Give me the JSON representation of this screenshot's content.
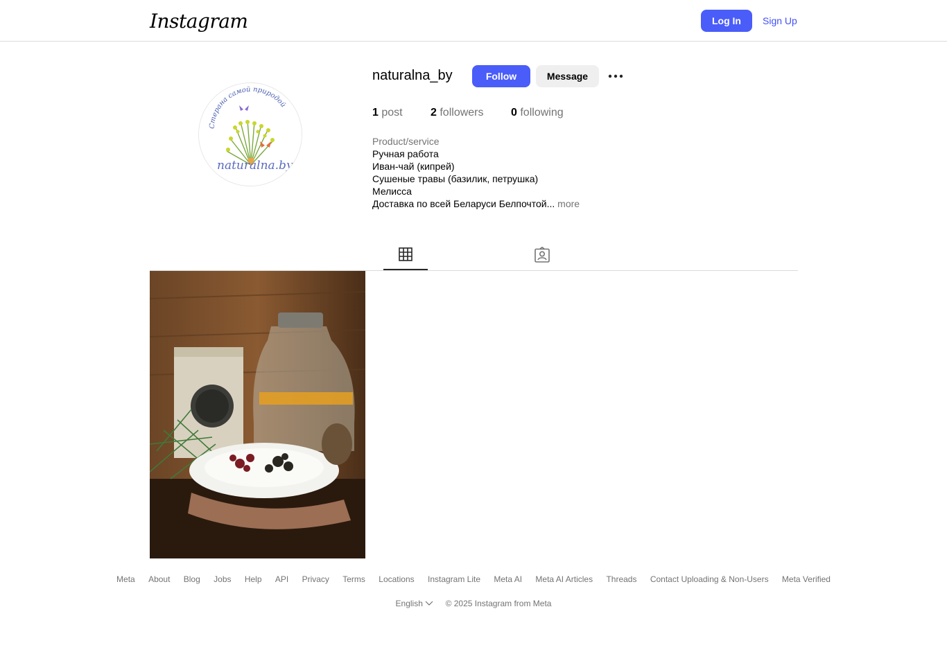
{
  "header": {
    "logo_text": "Instagram",
    "login_label": "Log In",
    "signup_label": "Sign Up"
  },
  "profile": {
    "username": "naturalna_by",
    "follow_label": "Follow",
    "message_label": "Message",
    "avatar_text_top": "Стерана самой природой",
    "avatar_text_bottom": "naturalna.by",
    "stats": {
      "posts_count": "1",
      "posts_label": "post",
      "followers_count": "2",
      "followers_label": "followers",
      "following_count": "0",
      "following_label": "following"
    },
    "bio": {
      "category": "Product/service",
      "lines": [
        "Ручная работа",
        "Иван-чай (кипрей)",
        "Сушеные травы (базилик, петрушка)",
        "Мелисса",
        "Доставка по всей Беларуси Белпочтой..."
      ],
      "more_label": "more"
    }
  },
  "tabs": [
    {
      "icon": "grid-icon",
      "active": true
    },
    {
      "icon": "tagged-icon",
      "active": false
    }
  ],
  "footer": {
    "links": [
      "Meta",
      "About",
      "Blog",
      "Jobs",
      "Help",
      "API",
      "Privacy",
      "Terms",
      "Locations",
      "Instagram Lite",
      "Meta AI",
      "Meta AI Articles",
      "Threads",
      "Contact Uploading & Non-Users",
      "Meta Verified"
    ],
    "language": "English",
    "copyright": "© 2025 Instagram from Meta"
  },
  "colors": {
    "accent": "#4a5df9",
    "link": "#4150f7",
    "muted": "#737373"
  }
}
